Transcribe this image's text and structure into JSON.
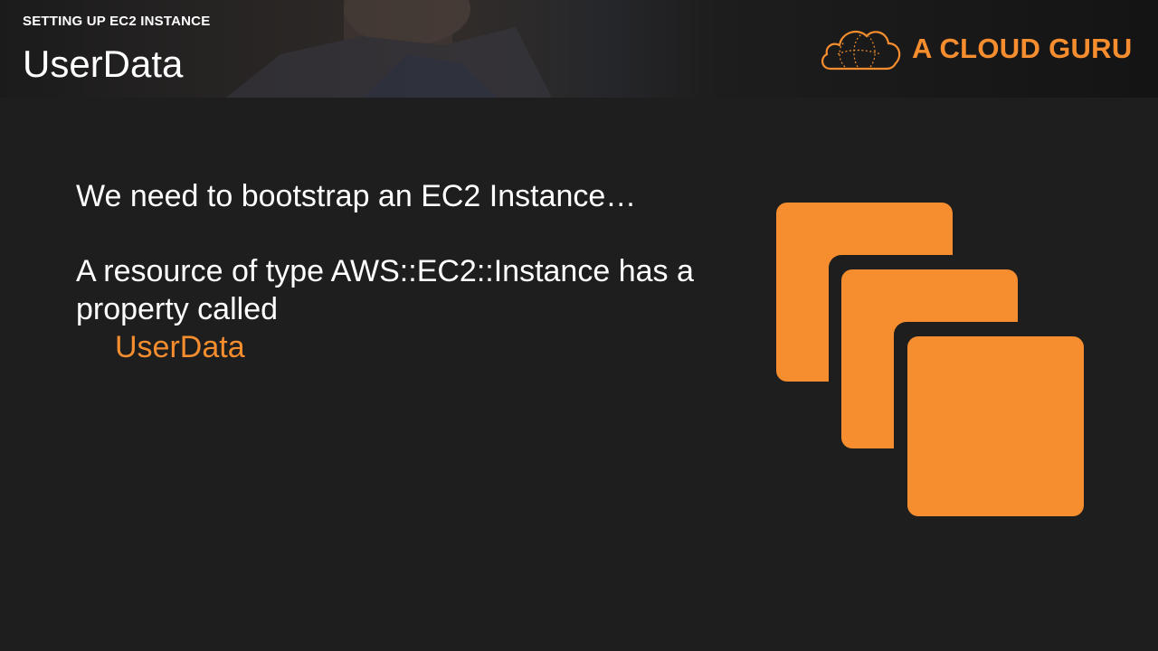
{
  "header": {
    "section_label": "SETTING UP EC2 INSTANCE",
    "title": "UserData",
    "logo_text": "A CLOUD GURU"
  },
  "content": {
    "line1": "We need to bootstrap an EC2 Instance…",
    "line2": "A resource of type AWS::EC2::Instance has a property called",
    "highlight": "UserData"
  },
  "icons": {
    "logo": "cloud-logo-icon",
    "graphic": "ec2-instances-icon"
  },
  "colors": {
    "accent": "#f68d2e",
    "background": "#1e1e1e",
    "text": "#ffffff"
  }
}
